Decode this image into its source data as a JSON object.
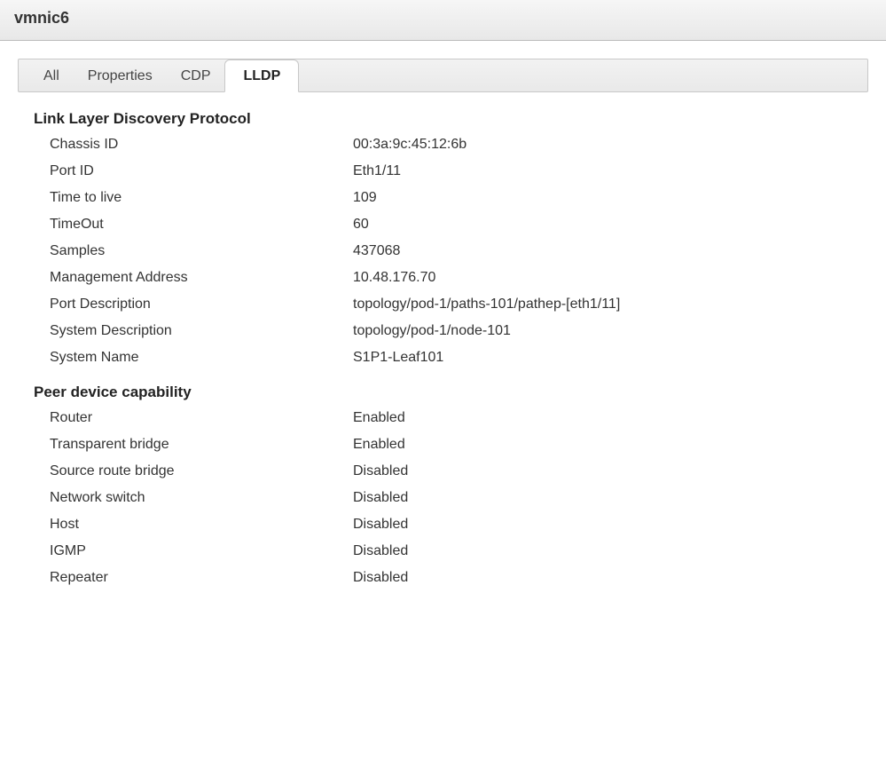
{
  "header": {
    "title": "vmnic6"
  },
  "tabs": [
    {
      "label": "All",
      "active": false
    },
    {
      "label": "Properties",
      "active": false
    },
    {
      "label": "CDP",
      "active": false
    },
    {
      "label": "LLDP",
      "active": true
    }
  ],
  "sections": {
    "lldp": {
      "title": "Link Layer Discovery Protocol",
      "rows": [
        {
          "key": "Chassis ID",
          "value": "00:3a:9c:45:12:6b"
        },
        {
          "key": "Port ID",
          "value": "Eth1/11"
        },
        {
          "key": "Time to live",
          "value": "109"
        },
        {
          "key": "TimeOut",
          "value": "60"
        },
        {
          "key": "Samples",
          "value": "437068"
        },
        {
          "key": "Management Address",
          "value": "10.48.176.70"
        },
        {
          "key": "Port Description",
          "value": "topology/pod-1/paths-101/pathep-[eth1/11]"
        },
        {
          "key": "System Description",
          "value": "topology/pod-1/node-101"
        },
        {
          "key": "System Name",
          "value": "S1P1-Leaf101"
        }
      ]
    },
    "peer": {
      "title": "Peer device capability",
      "rows": [
        {
          "key": "Router",
          "value": "Enabled"
        },
        {
          "key": "Transparent bridge",
          "value": "Enabled"
        },
        {
          "key": "Source route bridge",
          "value": "Disabled"
        },
        {
          "key": "Network switch",
          "value": "Disabled"
        },
        {
          "key": "Host",
          "value": "Disabled"
        },
        {
          "key": "IGMP",
          "value": "Disabled"
        },
        {
          "key": "Repeater",
          "value": "Disabled"
        }
      ]
    }
  }
}
